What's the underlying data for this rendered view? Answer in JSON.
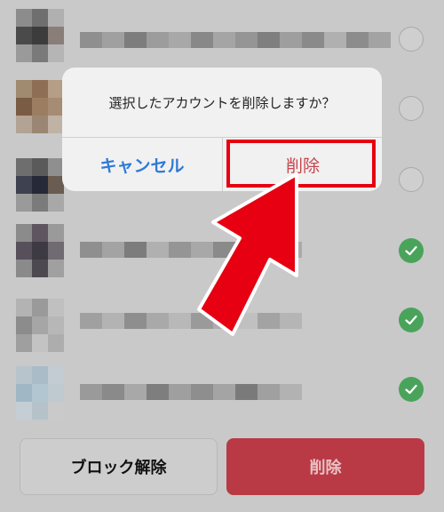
{
  "dialog": {
    "message": "選択したアカウントを削除しますか？",
    "cancel_label": "キャンセル",
    "delete_label": "削除"
  },
  "footer": {
    "unblock_label": "ブロック解除",
    "delete_label": "削除"
  },
  "accounts": [
    {
      "selected": false
    },
    {
      "selected": false
    },
    {
      "selected": false
    },
    {
      "selected": true
    },
    {
      "selected": true
    },
    {
      "selected": true
    }
  ],
  "colors": {
    "accent_blue": "#2f7ad6",
    "delete_red": "#c6454d",
    "highlight_red": "#e60012",
    "check_green": "#4aa35a"
  },
  "icons": [
    "checkmark-icon",
    "arrow-pointer-icon"
  ]
}
